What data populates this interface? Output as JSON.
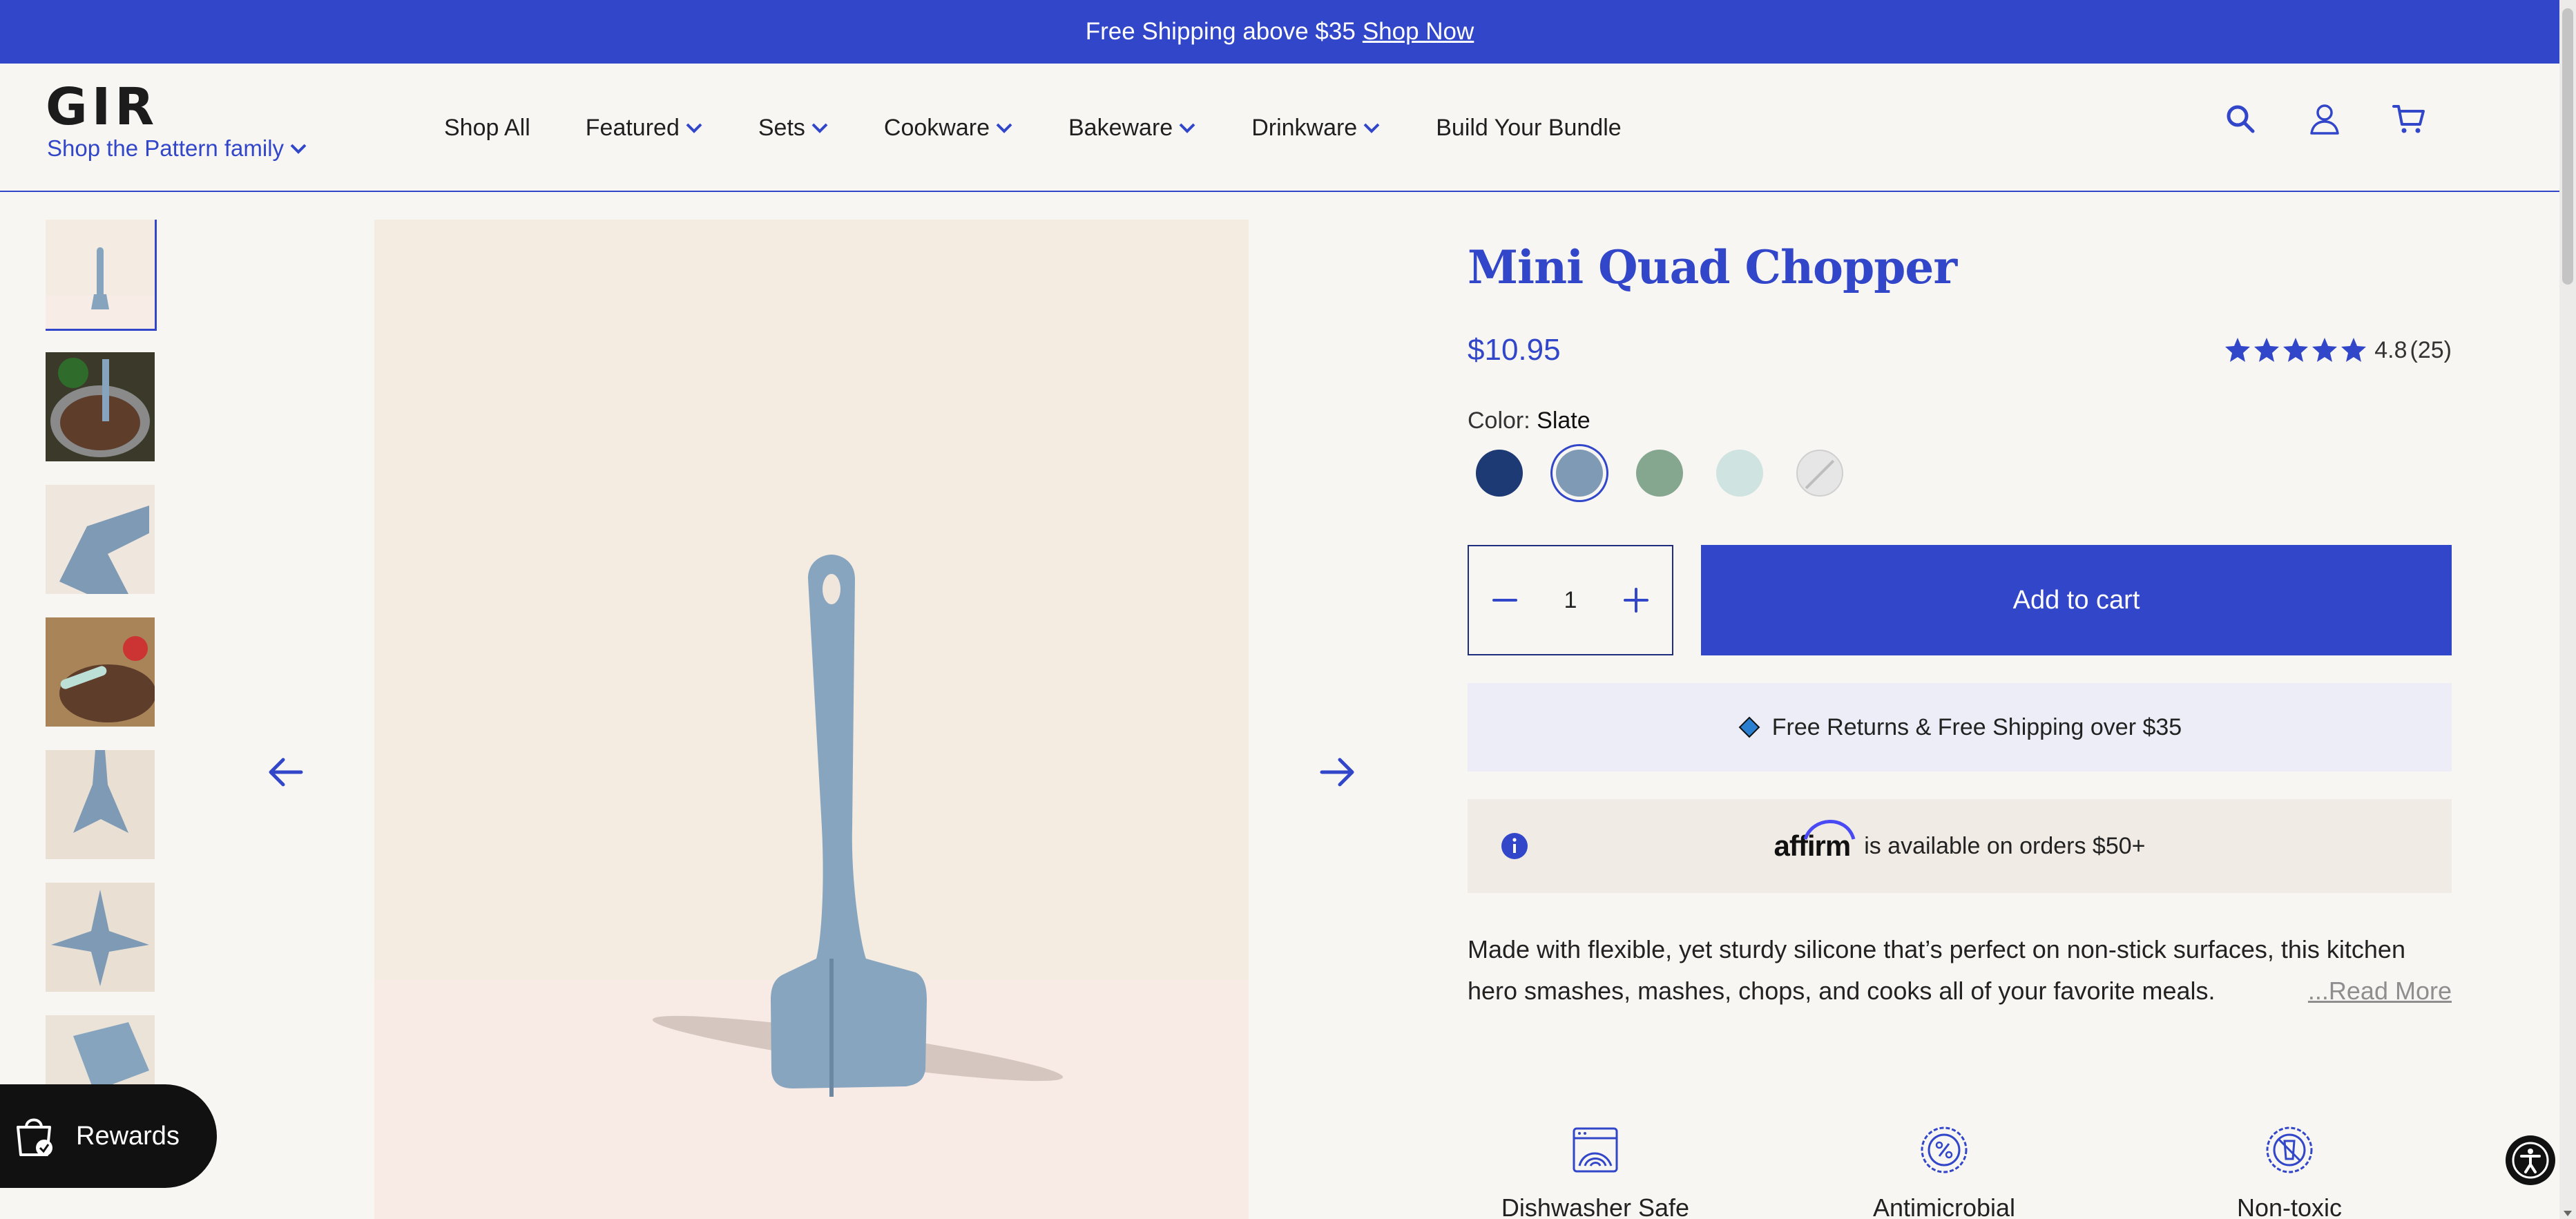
{
  "announcement": {
    "text": "Free Shipping above $35",
    "link": "Shop Now"
  },
  "header": {
    "logo": "GIR",
    "family_link": "Shop the Pattern family",
    "nav": [
      "Shop All",
      "Featured",
      "Sets",
      "Cookware",
      "Bakeware",
      "Drinkware",
      "Build Your Bundle"
    ],
    "icons": [
      "search-icon",
      "account-icon",
      "cart-icon"
    ]
  },
  "gallery": {
    "thumbnail_count": 7,
    "active_index": 0
  },
  "product": {
    "title": "Mini Quad Chopper",
    "price": "$10.95",
    "rating_value": "4.8",
    "rating_count": "(25)",
    "stars": 5,
    "color_label": "Color:",
    "color_value": "Slate",
    "swatches": [
      {
        "name": "Navy",
        "hex": "#1d3a74"
      },
      {
        "name": "Slate",
        "hex": "#7f9ab4",
        "selected": true
      },
      {
        "name": "Sage",
        "hex": "#86a78f"
      },
      {
        "name": "Mint",
        "hex": "#cfe3e1"
      },
      {
        "name": "Unavailable",
        "hex": "#e6e6e6",
        "disabled": true
      }
    ],
    "quantity": "1",
    "add_to_cart": "Add to cart",
    "returns_text": "Free Returns & Free Shipping over $35",
    "affirm_brand": "affirm",
    "affirm_text": "is available on orders $50+",
    "description": "Made with flexible, yet sturdy silicone that’s perfect on non-stick surfaces, this kitchen hero smashes, mashes, chops, and cooks all of your favorite meals.",
    "read_more": "...Read More"
  },
  "features": [
    {
      "label": "Dishwasher Safe",
      "icon": "dishwasher-icon"
    },
    {
      "label": "Antimicrobial",
      "icon": "antimicrobial-icon"
    },
    {
      "label": "Non-toxic",
      "icon": "non-toxic-icon"
    }
  ],
  "rewards": {
    "label": "Rewards"
  },
  "colors": {
    "brand": "#3146c8",
    "background": "#f8f6f3"
  }
}
